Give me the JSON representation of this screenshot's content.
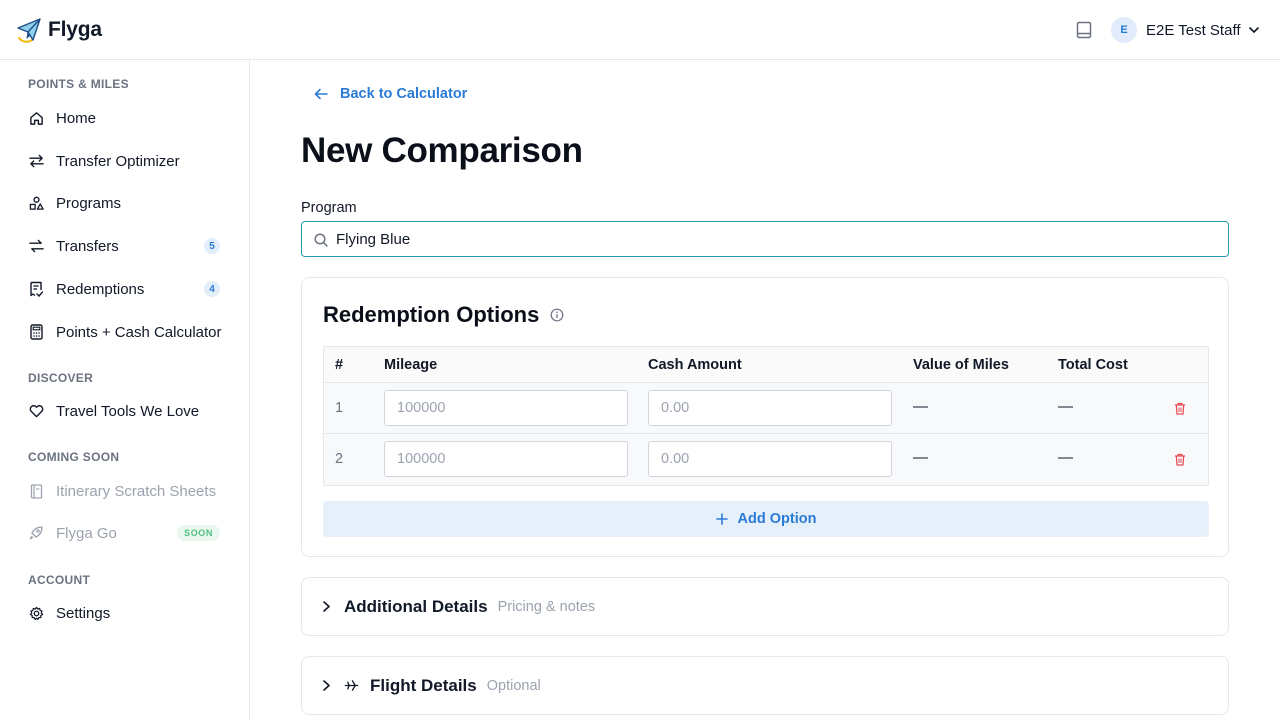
{
  "app": {
    "name": "Flyga"
  },
  "header": {
    "user_initial": "E",
    "user_name": "E2E Test Staff",
    "icons": {
      "docs": "book-icon",
      "caret": "chevron-down-icon"
    }
  },
  "sidebar": {
    "sections": {
      "points": "POINTS & MILES",
      "discover": "DISCOVER",
      "coming_soon": "COMING SOON",
      "account": "ACCOUNT"
    },
    "items": [
      {
        "label": "Home",
        "icon": "home-icon"
      },
      {
        "label": "Transfer Optimizer",
        "icon": "arrows-exchange-icon"
      },
      {
        "label": "Programs",
        "icon": "shapes-icon"
      },
      {
        "label": "Transfers",
        "icon": "transfer-icon",
        "badge": "5"
      },
      {
        "label": "Redemptions",
        "icon": "receipt-icon",
        "badge": "4"
      },
      {
        "label": "Points + Cash Calculator",
        "icon": "calculator-icon"
      },
      {
        "label": "Travel Tools We Love",
        "icon": "heart-icon"
      },
      {
        "label": "Itinerary Scratch Sheets",
        "icon": "notebook-icon"
      },
      {
        "label": "Flyga Go",
        "icon": "rocket-icon",
        "badge": "SOON"
      },
      {
        "label": "Settings",
        "icon": "gear-icon"
      }
    ]
  },
  "main": {
    "back_label": "Back to Calculator",
    "title": "New Comparison",
    "program_label": "Program",
    "program_value": "Flying Blue",
    "redemption": {
      "title": "Redemption Options",
      "columns": [
        "#",
        "Mileage",
        "Cash Amount",
        "Value of Miles",
        "Total Cost"
      ],
      "rows": [
        {
          "num": "1",
          "mileage_placeholder": "100000",
          "cash_placeholder": "0.00",
          "value": "—",
          "total": "—"
        },
        {
          "num": "2",
          "mileage_placeholder": "100000",
          "cash_placeholder": "0.00",
          "value": "—",
          "total": "—"
        }
      ],
      "add_label": "Add Option"
    },
    "accordions": [
      {
        "title": "Additional Details",
        "subtitle": "Pricing & notes"
      },
      {
        "title": "Flight Details",
        "subtitle": "Optional",
        "icon": "plane-icon"
      }
    ]
  },
  "colors": {
    "accent": "#2b7bd6",
    "input_focus": "#2b9bb5",
    "danger": "#e5484d",
    "soon_green": "#4fbf82"
  }
}
